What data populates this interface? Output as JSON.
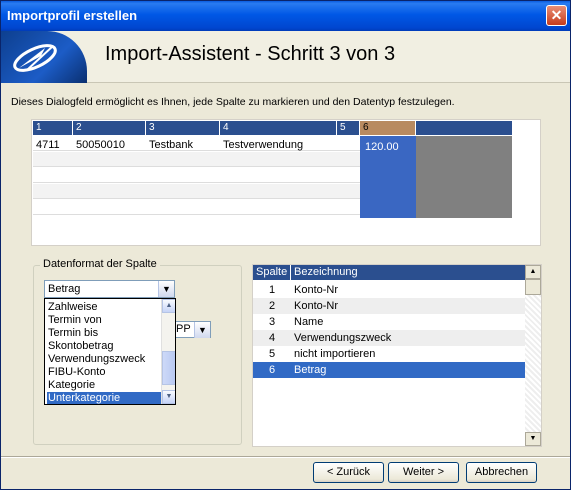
{
  "window": {
    "title": "Importprofil erstellen",
    "close": "✕"
  },
  "banner": {
    "title": "Import-Assistent - Schritt 3 von 3",
    "logo_icon": "satellite-logo-icon"
  },
  "description": "Dieses Dialogfeld ermöglicht es Ihnen, jede Spalte zu markieren und den Datentyp festzulegen.",
  "preview": {
    "columns": [
      "1",
      "2",
      "3",
      "4",
      "5",
      "6"
    ],
    "row": [
      "4711",
      "50050010",
      "Testbank",
      "Testverwendung",
      "",
      "120.00"
    ],
    "selected_column": "6"
  },
  "format": {
    "legend": "Datenformat der Spalte",
    "selected": "Betrag",
    "second_value": "PP",
    "options": [
      "Zahlweise",
      "Termin von",
      "Termin bis",
      "Skontobetrag",
      "Verwendungszweck",
      "FIBU-Konto",
      "Kategorie",
      "Unterkategorie"
    ],
    "highlighted": "Unterkategorie"
  },
  "mapping": {
    "headers": [
      "Spalte",
      "Bezeichnung"
    ],
    "rows": [
      {
        "spalte": "1",
        "bezeichnung": "Konto-Nr"
      },
      {
        "spalte": "2",
        "bezeichnung": "Konto-Nr"
      },
      {
        "spalte": "3",
        "bezeichnung": "Name"
      },
      {
        "spalte": "4",
        "bezeichnung": "Verwendungszweck"
      },
      {
        "spalte": "5",
        "bezeichnung": "nicht importieren"
      },
      {
        "spalte": "6",
        "bezeichnung": "Betrag"
      }
    ],
    "selected_row": "6"
  },
  "buttons": {
    "back": "< Zurück",
    "next": "Weiter >",
    "cancel": "Abbrechen"
  },
  "colors": {
    "title_bar": "#0058e6",
    "header_bg": "#2b4f8f",
    "selection": "#316ac5",
    "grey_area": "#808080"
  }
}
